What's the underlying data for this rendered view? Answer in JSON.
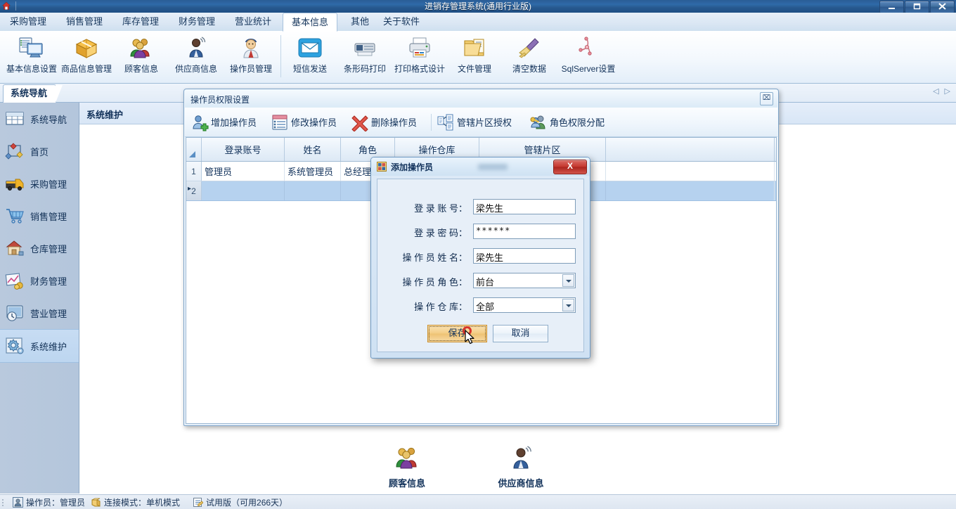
{
  "window": {
    "title": "进销存管理系统(通用行业版)",
    "minimize_label": "─",
    "maximize_label": "❐",
    "close_label": "✕"
  },
  "menubar": {
    "tabs": [
      {
        "label": "采购管理",
        "active": false
      },
      {
        "label": "销售管理",
        "active": false
      },
      {
        "label": "库存管理",
        "active": false
      },
      {
        "label": "财务管理",
        "active": false
      },
      {
        "label": "营业统计",
        "active": false
      },
      {
        "label": "基本信息",
        "active": true
      },
      {
        "label": "其他",
        "active": false
      },
      {
        "label": "关于软件",
        "active": false
      }
    ]
  },
  "ribbon": {
    "group1": [
      {
        "label": "基本信息设置",
        "icon": "settings-monitor-icon"
      },
      {
        "label": "商品信息管理",
        "icon": "box-icon"
      },
      {
        "label": "顾客信息",
        "icon": "customers-icon"
      },
      {
        "label": "供应商信息",
        "icon": "supplier-person-icon"
      },
      {
        "label": "操作员管理",
        "icon": "operator-icon"
      }
    ],
    "group2": [
      {
        "label": "短信发送",
        "icon": "envelope-icon"
      },
      {
        "label": "条形码打印",
        "icon": "barcode-printer-icon"
      },
      {
        "label": "打印格式设计",
        "icon": "printer-icon"
      },
      {
        "label": "文件管理",
        "icon": "folder-icon"
      },
      {
        "label": "清空数据",
        "icon": "broom-icon"
      },
      {
        "label": "SqlServer设置",
        "icon": "sqlserver-icon"
      }
    ]
  },
  "navtab": {
    "label": "系统导航",
    "prev_arrow": "◁",
    "next_arrow": "▷"
  },
  "sidebar": {
    "items": [
      {
        "label": "系统导航",
        "icon": "grid-table-icon",
        "active": false
      },
      {
        "label": "首页",
        "icon": "home-diamond-icon",
        "active": false
      },
      {
        "label": "采购管理",
        "icon": "truck-icon",
        "active": false
      },
      {
        "label": "销售管理",
        "icon": "shopping-cart-icon",
        "active": false
      },
      {
        "label": "仓库管理",
        "icon": "warehouse-house-icon",
        "active": false
      },
      {
        "label": "财务管理",
        "icon": "chart-money-icon",
        "active": false
      },
      {
        "label": "营业管理",
        "icon": "clock-screen-icon",
        "active": false
      },
      {
        "label": "系统维护",
        "icon": "gear-icon",
        "active": true
      }
    ]
  },
  "workspace": {
    "header_title": "系统维护",
    "desktop_icons": [
      {
        "label": "顾客信息",
        "icon": "customers-icon"
      },
      {
        "label": "供应商信息",
        "icon": "supplier-person-icon"
      }
    ]
  },
  "mdi": {
    "title": "操作员权限设置",
    "close_label": "⌧",
    "toolbar": [
      {
        "label": "增加操作员",
        "icon": "add-user-icon"
      },
      {
        "label": "修改操作员",
        "icon": "edit-list-icon"
      },
      {
        "label": "删除操作员",
        "icon": "delete-x-icon"
      },
      {
        "label": "管辖片区授权",
        "icon": "assign-area-icon"
      },
      {
        "label": "角色权限分配",
        "icon": "role-key-icon"
      }
    ],
    "grid": {
      "columns": [
        "登录账号",
        "姓名",
        "角色",
        "操作仓库",
        "管辖片区"
      ],
      "rows": [
        {
          "index": "1",
          "cells": [
            "管理员",
            "系统管理员",
            "总经理",
            "",
            ""
          ],
          "selected": false
        },
        {
          "index": "2",
          "cells": [
            "",
            "",
            "",
            "",
            ""
          ],
          "selected": true
        }
      ]
    }
  },
  "dialog": {
    "title": "添加操作员",
    "close_label": "X",
    "fields": [
      {
        "label": "登  录  账  号：",
        "value": "梁先生",
        "type": "text",
        "name": "login-account"
      },
      {
        "label": "登  录  密  码：",
        "value": "******",
        "type": "password",
        "name": "login-password"
      },
      {
        "label": "操 作 员 姓 名：",
        "value": "梁先生",
        "type": "text",
        "name": "operator-name"
      },
      {
        "label": "操 作 员 角 色：",
        "value": "前台",
        "type": "select",
        "name": "operator-role"
      },
      {
        "label": "操  作  仓  库：",
        "value": "全部",
        "type": "select",
        "name": "operator-warehouse"
      }
    ],
    "save_label": "保存",
    "cancel_label": "取消"
  },
  "statusbar": {
    "items": [
      {
        "label": "操作员：管理员",
        "icon": "user-badge-icon"
      },
      {
        "label": "连接模式：单机模式",
        "icon": "database-icon"
      },
      {
        "label": "试用版（可用266天）",
        "icon": "note-icon"
      }
    ]
  },
  "colors": {
    "titlebar_blue": "#2f6aa8",
    "accent_blue": "#12325a",
    "selected_row": "#b6d2ef",
    "save_button_orange": "#f3cd86",
    "close_red": "#c4382f",
    "sidebar_bg": "#b6c8dd"
  }
}
